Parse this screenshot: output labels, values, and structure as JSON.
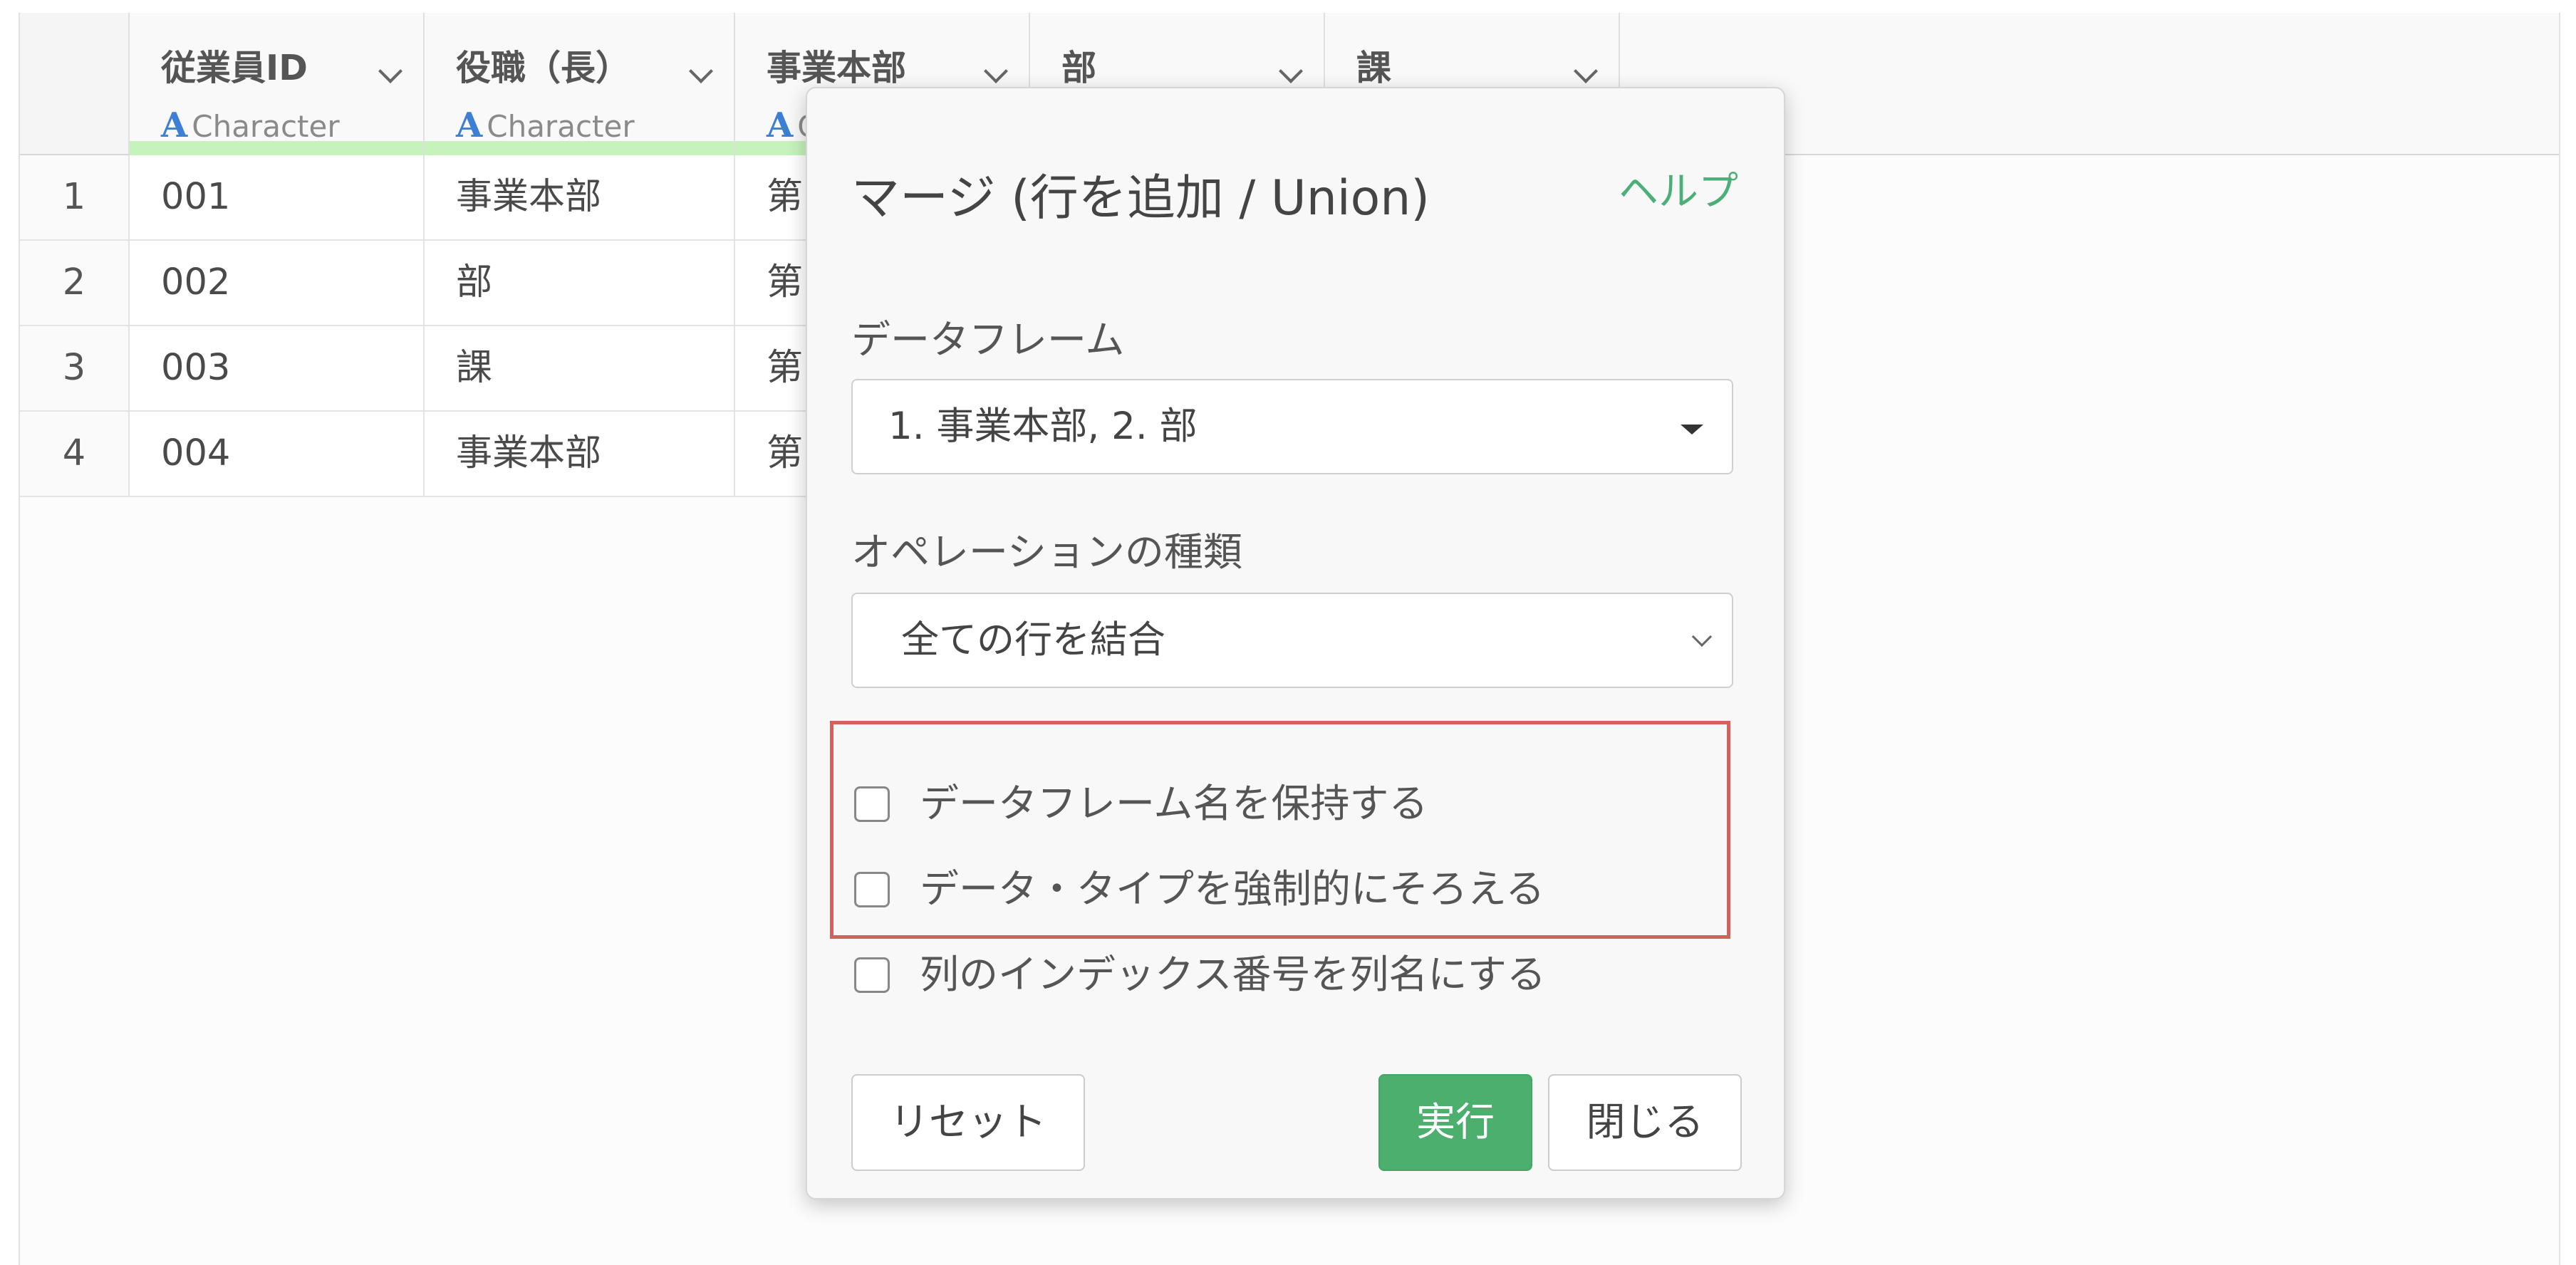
{
  "table": {
    "columns": [
      {
        "name": "従業員ID",
        "type": "Character"
      },
      {
        "name": "役職（長）",
        "type": "Character"
      },
      {
        "name": "事業本部",
        "type": "C"
      },
      {
        "name": "部",
        "type": ""
      },
      {
        "name": "課",
        "type": ""
      }
    ],
    "type_letter": "A",
    "rows": [
      {
        "num": "1",
        "id": "001",
        "role": "事業本部",
        "dept": "第"
      },
      {
        "num": "2",
        "id": "002",
        "role": "部",
        "dept": "第"
      },
      {
        "num": "3",
        "id": "003",
        "role": "課",
        "dept": "第"
      },
      {
        "num": "4",
        "id": "004",
        "role": "事業本部",
        "dept": "第"
      }
    ]
  },
  "dialog": {
    "title": "マージ (行を追加 / Union)",
    "help": "ヘルプ",
    "dataframe_label": "データフレーム",
    "dataframe_value": "1. 事業本部, 2. 部",
    "operation_label": "オペレーションの種類",
    "operation_value": "全ての行を結合",
    "checkboxes": [
      {
        "label": "データフレーム名を保持する",
        "checked": false
      },
      {
        "label": "データ・タイプを強制的にそろえる",
        "checked": false
      },
      {
        "label": "列のインデックス番号を列名にする",
        "checked": false
      }
    ],
    "reset_label": "リセット",
    "run_label": "実行",
    "close_label": "閉じる"
  },
  "colors": {
    "accent_green": "#4caf6e",
    "highlight_red": "#d5615c",
    "type_icon_blue": "#3d7fd4",
    "quality_bar_green": "#c6f2bc"
  }
}
